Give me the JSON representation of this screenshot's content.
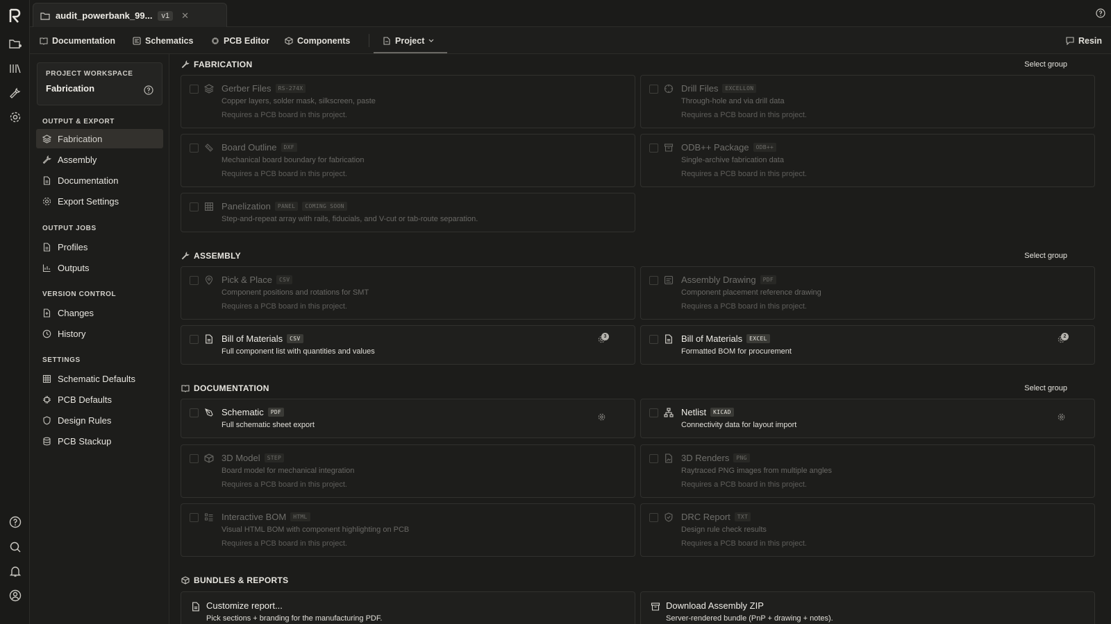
{
  "rail": {
    "icons": [
      "logo-icon",
      "folder-icon",
      "library-icon",
      "wrench-icon",
      "settings-icon",
      "help-icon",
      "search-icon",
      "bell-icon",
      "user-icon"
    ]
  },
  "topbar": {
    "file_name": "audit_powerbank_99...",
    "version": "v1",
    "close": "✕"
  },
  "nav": {
    "documentation": "Documentation",
    "schematics": "Schematics",
    "pcb_editor": "PCB Editor",
    "components": "Components",
    "project": "Project",
    "resin": "Resin"
  },
  "sidebar": {
    "workspace_label": "PROJECT WORKSPACE",
    "workspace_value": "Fabrication",
    "sections": {
      "output_export": "OUTPUT & EXPORT",
      "output_jobs": "OUTPUT JOBS",
      "version_control": "VERSION CONTROL",
      "settings": "SETTINGS"
    },
    "items": {
      "fabrication": "Fabrication",
      "assembly": "Assembly",
      "documentation": "Documentation",
      "export_settings": "Export Settings",
      "profiles": "Profiles",
      "outputs": "Outputs",
      "changes": "Changes",
      "history": "History",
      "schematic_defaults": "Schematic Defaults",
      "pcb_defaults": "PCB Defaults",
      "design_rules": "Design Rules",
      "pcb_stackup": "PCB Stackup"
    }
  },
  "main": {
    "select_group": "Select group",
    "requires_pcb": "Requires a PCB board in this project.",
    "groups": {
      "fabrication": "FABRICATION",
      "assembly": "ASSEMBLY",
      "documentation": "DOCUMENTATION",
      "bundles": "BUNDLES & REPORTS"
    },
    "cards": {
      "gerber": {
        "title": "Gerber Files",
        "tag": "RS-274X",
        "desc": "Copper layers, solder mask, silkscreen, paste"
      },
      "drill": {
        "title": "Drill Files",
        "tag": "EXCELLON",
        "desc": "Through-hole and via drill data"
      },
      "outline": {
        "title": "Board Outline",
        "tag": "DXF",
        "desc": "Mechanical board boundary for fabrication"
      },
      "odb": {
        "title": "ODB++ Package",
        "tag": "ODB++",
        "desc": "Single-archive fabrication data"
      },
      "panel": {
        "title": "Panelization",
        "tag": "PANEL",
        "tag2": "COMING SOON",
        "desc": "Step-and-repeat array with rails, fiducials, and V-cut or tab-route separation."
      },
      "pnp": {
        "title": "Pick & Place",
        "tag": "CSV",
        "desc": "Component positions and rotations for SMT"
      },
      "asm_drawing": {
        "title": "Assembly Drawing",
        "tag": "PDF",
        "desc": "Component placement reference drawing"
      },
      "bom_csv": {
        "title": "Bill of Materials",
        "tag": "CSV",
        "desc": "Full component list with quantities and values",
        "badge": "3"
      },
      "bom_excel": {
        "title": "Bill of Materials",
        "tag": "EXCEL",
        "desc": "Formatted BOM for procurement",
        "badge": "2"
      },
      "schematic": {
        "title": "Schematic",
        "tag": "PDF",
        "desc": "Full schematic sheet export"
      },
      "netlist": {
        "title": "Netlist",
        "tag": "KICAD",
        "desc": "Connectivity data for layout import"
      },
      "model3d": {
        "title": "3D Model",
        "tag": "STEP",
        "desc": "Board model for mechanical integration"
      },
      "renders": {
        "title": "3D Renders",
        "tag": "PNG",
        "desc": "Raytraced PNG images from multiple angles"
      },
      "ibom": {
        "title": "Interactive BOM",
        "tag": "HTML",
        "desc": "Visual HTML BOM with component highlighting on PCB"
      },
      "drc": {
        "title": "DRC Report",
        "tag": "TXT",
        "desc": "Design rule check results"
      },
      "report": {
        "title": "Customize report...",
        "desc": "Pick sections + branding for the manufacturing PDF."
      },
      "zip": {
        "title": "Download Assembly ZIP",
        "desc": "Server-rendered bundle (PnP + drawing + notes)."
      }
    }
  }
}
